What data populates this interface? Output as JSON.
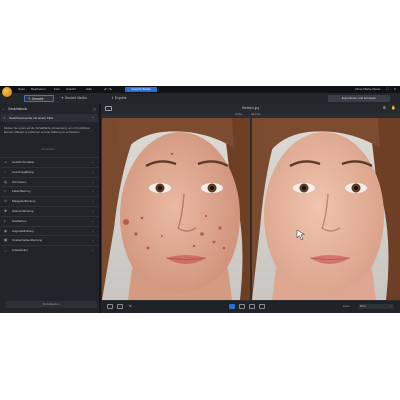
{
  "menu": {
    "items": [
      "Datei",
      "Bearbeiten",
      "Foto",
      "Ansicht",
      "Hilfe"
    ],
    "active_tab": "Gesicht Studio",
    "right_text": "Ohne Marke Menü",
    "window_controls": "— ☐ ✕",
    "undo_redo": "↶ ↷"
  },
  "toolbar": {
    "tabs": [
      {
        "label": "Gesicht",
        "icon": "brush-icon"
      },
      {
        "label": "Gesicht Studio",
        "icon": "sparkle-icon"
      },
      {
        "label": "Exporte",
        "icon": "export-icon"
      }
    ],
    "save_label": "Exportieren und anzeigen"
  },
  "left_panel": {
    "header": "Gesichtstools",
    "active_tool": "Gesichtsretusche mit einem Klick",
    "description": "Klicken Sie unten auf die Schaltfläche [Anwenden], um in Porträtfotos kleinere Mängel zu entfernen und die Glättung zu verbessern.",
    "apply_label": "Anwenden",
    "tools": [
      "Gesicht Kontakte",
      "Gesichtsglättung",
      "Schminken",
      "Faltenfilterung",
      "Mängelentfernung",
      "Glanzentfernung",
      "Hautfarben",
      "Augenaufhellung",
      "Unebenheitsentfernung",
      "Lidausfreifer"
    ],
    "reset_label": "Zurücksetzen"
  },
  "viewer": {
    "title": "Webfoto.jpg",
    "before_label": "Vorher",
    "after_label": "Nachher",
    "zoom_label": "Zoom:",
    "zoom_value": "Fitt it"
  },
  "colors": {
    "accent": "#2b6fd6",
    "background": "#1b1d21",
    "panel": "#222429"
  }
}
